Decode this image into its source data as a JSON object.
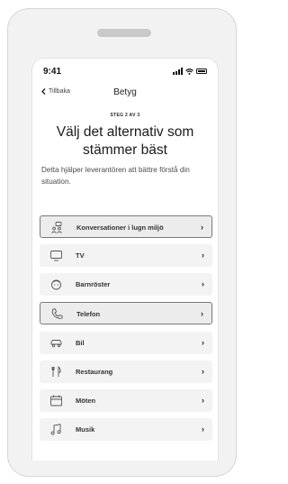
{
  "status_bar": {
    "time": "9:41"
  },
  "nav": {
    "back_label": "Tillbaka",
    "title": "Betyg"
  },
  "step_label": "STEG 2 AV 3",
  "heading": "Välj det alternativ som stämmer bäst",
  "description": "Detta hjälper leverantören att bättre förstå din situation.",
  "options": [
    {
      "label": "Konversationer i lugn miljö",
      "icon": "people-icon",
      "selected": true
    },
    {
      "label": "TV",
      "icon": "monitor-icon",
      "selected": false
    },
    {
      "label": "Barnröster",
      "icon": "child-face-icon",
      "selected": false
    },
    {
      "label": "Telefon",
      "icon": "phone-icon",
      "selected": true
    },
    {
      "label": "Bil",
      "icon": "car-icon",
      "selected": false
    },
    {
      "label": "Restaurang",
      "icon": "cutlery-icon",
      "selected": false
    },
    {
      "label": "Möten",
      "icon": "calendar-icon",
      "selected": false
    },
    {
      "label": "Musik",
      "icon": "music-note-icon",
      "selected": false
    }
  ],
  "colors": {
    "selected_border": "#7a7a7e",
    "option_bg": "#f3f3f4"
  }
}
